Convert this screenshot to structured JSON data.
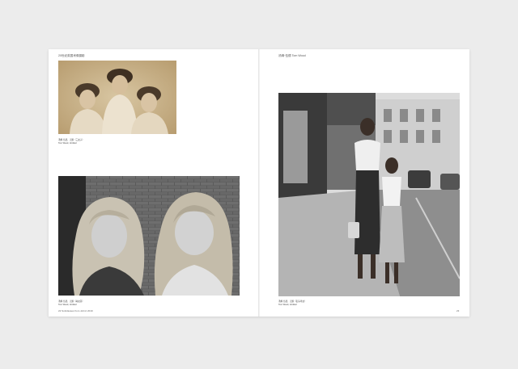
{
  "spread": {
    "left_page": {
      "running_head": "20世纪英国肖像摄影",
      "photo_top": {
        "alt": "Sepia portrait of three young women",
        "caption_line1": "汤姆·伍德，无题（三女子）",
        "caption_line2": "Tom Wood, Untitled"
      },
      "photo_bottom": {
        "alt": "Two girls in front of a brick wall",
        "caption_line1": "汤姆·伍德，无题（两女孩）",
        "caption_line2": "Tom Wood, Untitled"
      },
      "folio": "22   Subclasses from Johnz 2019"
    },
    "right_page": {
      "running_head": "汤姆·伍德   Tom Wood",
      "photo": {
        "alt": "Woman and girl standing on a street",
        "caption_line1": "汤姆·伍德，无题（街头母女）",
        "caption_line2": "Tom Wood, Untitled"
      },
      "folio": "23"
    }
  }
}
